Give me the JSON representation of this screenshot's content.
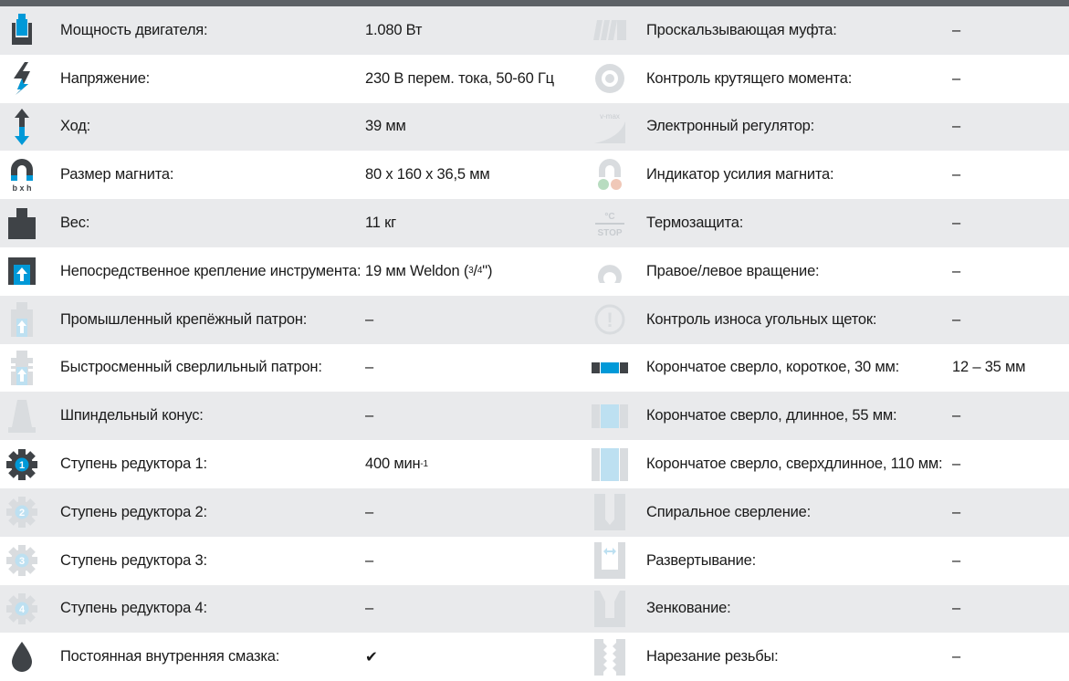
{
  "colors": {
    "header": "#5d6166",
    "row_alt": "#e9eaec",
    "icon_active": "#0099d8",
    "icon_dark": "#3f4347",
    "icon_inactive": "#d9dcdf"
  },
  "left": [
    {
      "icon": "motor-power-icon",
      "label": "Мощность двигателя:",
      "value": "1.080 Вт"
    },
    {
      "icon": "lightning-voltage-icon",
      "label": "Напряжение:",
      "value": "230 В перем. тока, 50-60 Гц"
    },
    {
      "icon": "stroke-arrow-icon",
      "label": "Ход:",
      "value": "39 мм"
    },
    {
      "icon": "magnet-icon",
      "icon_text": "b x h",
      "label": "Размер магнита:",
      "value": "80 x 160 x 36,5 мм"
    },
    {
      "icon": "weight-icon",
      "label": "Вес:",
      "value": "11 кг"
    },
    {
      "icon": "direct-tool-mount-icon",
      "label": "Непосредственное крепление инструмента:",
      "value_prefix": "19 мм Weldon (",
      "value_sup": "3",
      "value_slash": "/",
      "value_sub": "4",
      "value_suffix": "\")"
    },
    {
      "icon": "industrial-chuck-icon",
      "label": "Промышленный крепёжный патрон:",
      "value": "–"
    },
    {
      "icon": "quick-change-chuck-icon",
      "label": "Быстросменный сверлильный патрон:",
      "value": "–"
    },
    {
      "icon": "spindle-taper-icon",
      "label": "Шпиндельный конус:",
      "value": "–"
    },
    {
      "icon": "gear-1-icon",
      "icon_text": "1",
      "label": "Ступень редуктора 1:",
      "value": "400 мин",
      "value_sup": "-1"
    },
    {
      "icon": "gear-2-icon",
      "icon_text": "2",
      "label": "Ступень редуктора 2:",
      "value": "–"
    },
    {
      "icon": "gear-3-icon",
      "icon_text": "3",
      "label": "Ступень редуктора 3:",
      "value": "–"
    },
    {
      "icon": "gear-4-icon",
      "icon_text": "4",
      "label": "Ступень редуктора 4:",
      "value": "–"
    },
    {
      "icon": "oil-drop-icon",
      "label": "Постоянная внутренняя смазка:",
      "value": "✔"
    }
  ],
  "right": [
    {
      "icon": "slip-clutch-icon",
      "label": "Проскальзывающая муфта:",
      "value": "–"
    },
    {
      "icon": "torque-control-icon",
      "label": "Контроль крутящего момента:",
      "value": "–"
    },
    {
      "icon": "vmax-regulator-icon",
      "icon_text": "v-max",
      "label": "Электронный регулятор:",
      "value": "–"
    },
    {
      "icon": "magnet-indicator-icon",
      "label": "Индикатор усилия магнита:",
      "value": "–"
    },
    {
      "icon": "thermal-stop-icon",
      "icon_text_top": "°C",
      "icon_text_bottom": "STOP",
      "label": "Термозащита:",
      "value": "–"
    },
    {
      "icon": "rotation-icon",
      "label": "Правое/левое вращение:",
      "value": "–"
    },
    {
      "icon": "brush-wear-icon",
      "icon_text": "!",
      "label": "Контроль износа угольных щеток:",
      "value": "–"
    },
    {
      "icon": "core-drill-short-icon",
      "label": "Корончатое сверло, короткое, 30 мм:",
      "value": "12 – 35 мм"
    },
    {
      "icon": "core-drill-long-icon",
      "label": "Корончатое сверло, длинное, 55 мм:",
      "value": "–"
    },
    {
      "icon": "core-drill-xlong-icon",
      "label": "Корончатое сверло, сверхдлинное, 110 мм:",
      "value": "–"
    },
    {
      "icon": "twist-drill-icon",
      "label": "Спиральное сверление:",
      "value": "–"
    },
    {
      "icon": "reaming-icon",
      "label": "Развертывание:",
      "value": "–"
    },
    {
      "icon": "countersink-icon",
      "label": "Зенкование:",
      "value": "–"
    },
    {
      "icon": "tapping-icon",
      "label": "Нарезание резьбы:",
      "value": "–"
    }
  ]
}
